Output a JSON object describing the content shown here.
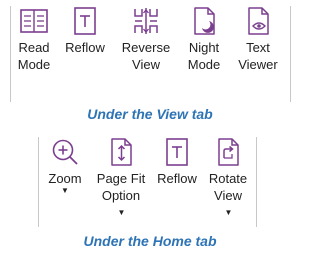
{
  "accent_color": "#7b3f8f",
  "caption_color": "#2e74b5",
  "view_tab": {
    "caption": "Under the View tab",
    "buttons": [
      {
        "icon": "read-mode-icon",
        "line1": "Read",
        "line2": "Mode"
      },
      {
        "icon": "reflow-icon",
        "line1": "Reflow",
        "line2": ""
      },
      {
        "icon": "reverse-view-icon",
        "line1": "Reverse",
        "line2": "View"
      },
      {
        "icon": "night-mode-icon",
        "line1": "Night",
        "line2": "Mode"
      },
      {
        "icon": "text-viewer-icon",
        "line1": "Text",
        "line2": "Viewer"
      }
    ]
  },
  "home_tab": {
    "caption": "Under the Home tab",
    "buttons": [
      {
        "icon": "zoom-icon",
        "line1": "Zoom",
        "line2": ""
      },
      {
        "icon": "page-fit-icon",
        "line1": "Page Fit",
        "line2": "Option"
      },
      {
        "icon": "reflow-icon",
        "line1": "Reflow",
        "line2": ""
      },
      {
        "icon": "rotate-view-icon",
        "line1": "Rotate",
        "line2": "View"
      }
    ]
  }
}
